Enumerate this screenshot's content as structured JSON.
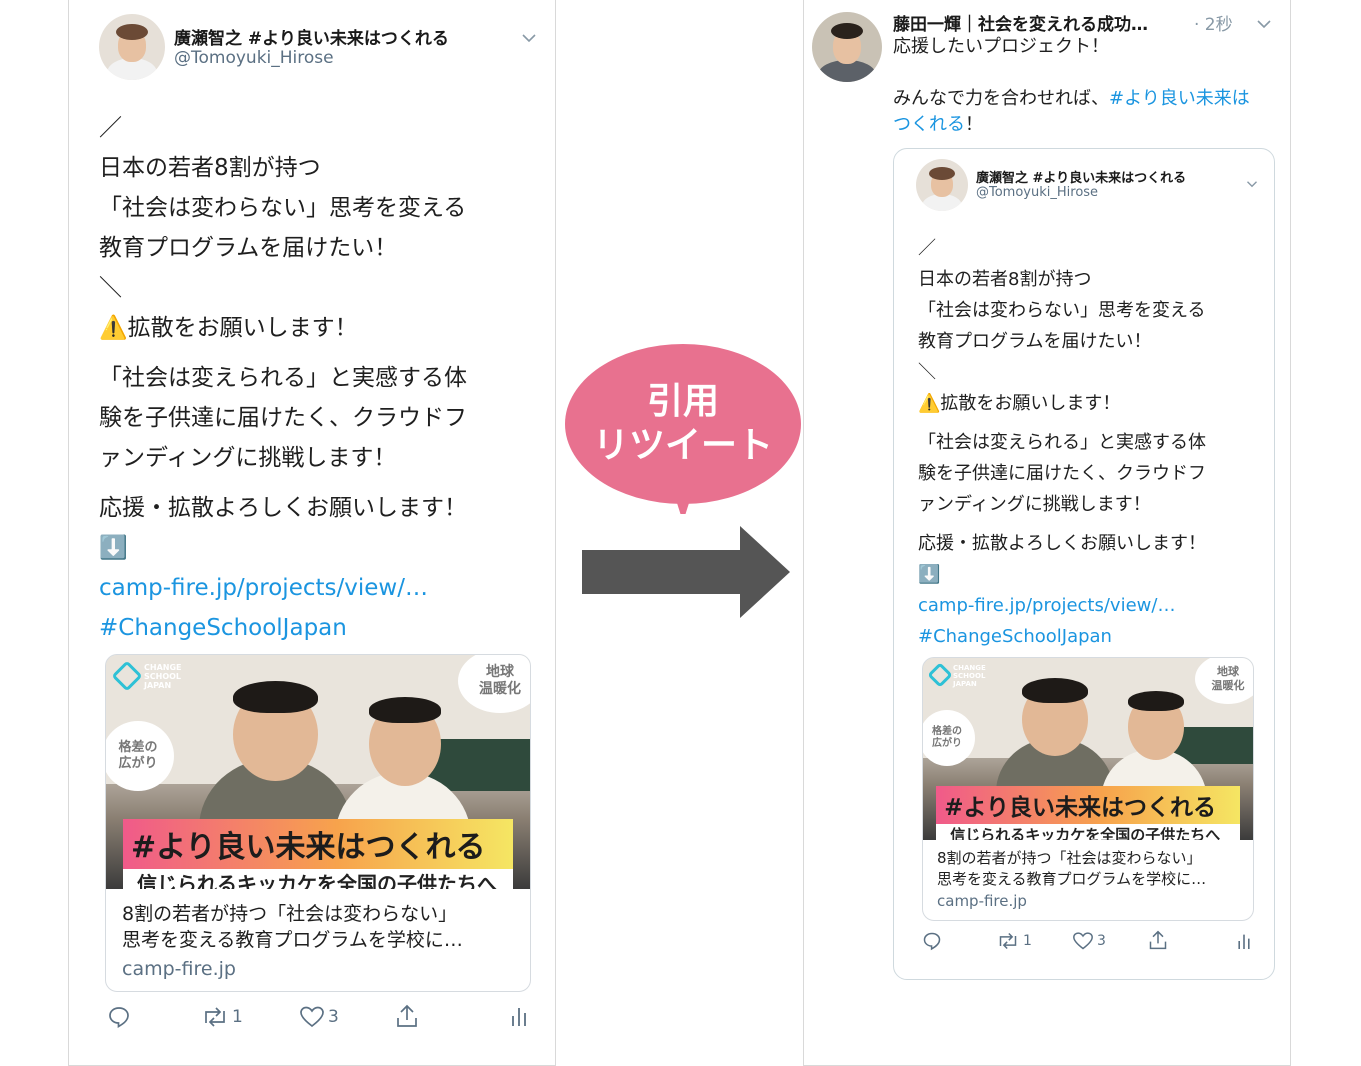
{
  "original_tweet": {
    "name": "廣瀬智之 #より良い未来はつくれる",
    "handle": "@Tomoyuki_Hirose",
    "body": [
      "／\n日本の若者8割が持つ\n「社会は変わらない」思考を変える\n教育プログラムを届けたい！\n＼\n⚠️拡散をお願いします！",
      "「社会は変えられる」と実感する体\n験を子供達に届けたく、クラウドフ\nァンディングに挑戦します！",
      "応援・拡散よろしくお願いします！\n⬇️"
    ],
    "link": "camp-fire.jp/projects/view/…",
    "hashtag": "#ChangeSchoolJapan",
    "card": {
      "logo": "CHANGE\nSCHOOL\nJAPAN",
      "bubble_top": "地球\n温暖化",
      "bubble_left": "格差の\n広がり",
      "banner": "#より良い未来はつくれる",
      "strip": "信じられるキッカケを全国の子供たちへ",
      "title": "8割の若者が持つ「社会は変わらない」\n思考を変える教育プログラムを学校に…",
      "domain": "camp-fire.jp"
    },
    "actions": {
      "reply_icon": "reply-icon",
      "retweet_count": "1",
      "like_count": "3",
      "share_icon": "share-icon",
      "analytics_icon": "analytics-icon"
    }
  },
  "callout": {
    "line1": "引用",
    "line2": "リツイート",
    "color": "#e8718f"
  },
  "arrow_color": "#555555",
  "quote_tweet": {
    "name": "藤田一輝｜社会を変えれる成功…",
    "timestamp": "· 2秒",
    "body_line1": "応援したいプロジェクト！",
    "body_line2": "みんなで力を合わせれば、",
    "hashtag": "#より良い未来は\nつくれる",
    "body_end": "！"
  },
  "colors": {
    "link": "#1b95e0",
    "muted": "#5b7083"
  }
}
